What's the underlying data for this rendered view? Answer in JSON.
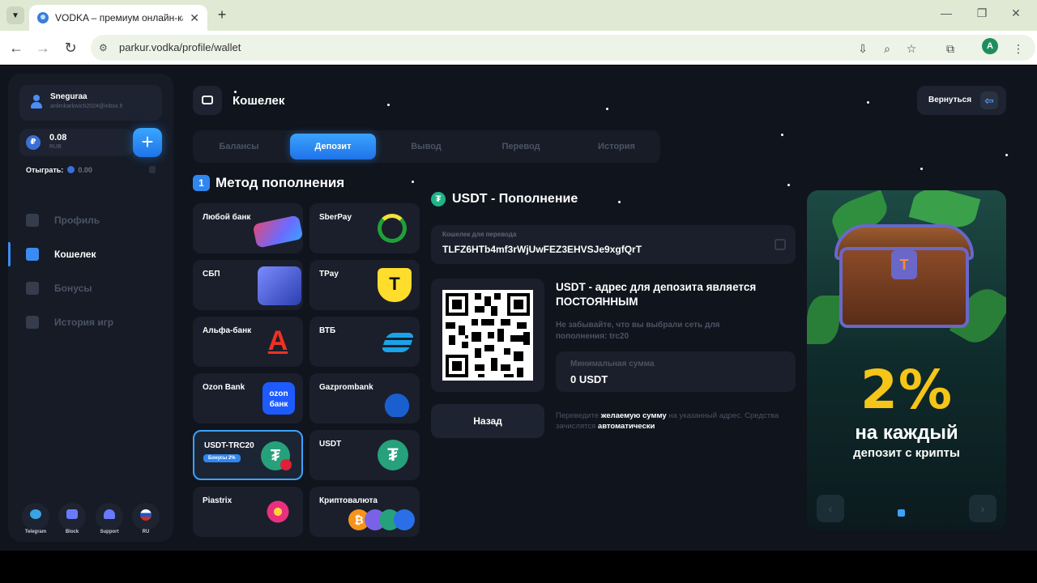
{
  "browser": {
    "tab_title": "VODKA – премиум онлайн-ка",
    "url": "parkur.vodka/profile/wallet",
    "profile_initial": "A"
  },
  "sidebar": {
    "username": "Snegurаа",
    "email": "anlimkаrlovich2024@inbox.lt",
    "balance": "0.08",
    "currency": "RUB",
    "wager_label": "Отыграть:",
    "wager_value": "0.00",
    "menu": [
      {
        "label": "Профиль",
        "icon": "user-icon"
      },
      {
        "label": "Кошелек",
        "icon": "wallet-icon"
      },
      {
        "label": "Бонусы",
        "icon": "gift-icon"
      },
      {
        "label": "История игр",
        "icon": "history-icon"
      }
    ],
    "social": [
      {
        "label": "Telegram",
        "icon": "telegram-icon",
        "color": "#3aa3e3"
      },
      {
        "label": "Block",
        "icon": "lock-icon",
        "color": "#6a7aff"
      },
      {
        "label": "Support",
        "icon": "support-icon",
        "color": "#6a7aff"
      },
      {
        "label": "RU",
        "icon": "russia-flag-icon",
        "color": "#d52b1e"
      }
    ]
  },
  "header": {
    "title": "Кошелек",
    "back_label": "Вернуться"
  },
  "tabs": [
    "Балансы",
    "Депозит",
    "Вывод",
    "Перевод",
    "История"
  ],
  "method": {
    "step": "1",
    "title": "Метод пополнения",
    "cards": [
      {
        "name": "Любой банк"
      },
      {
        "name": "SberPay"
      },
      {
        "name": "СБП"
      },
      {
        "name": "TPay"
      },
      {
        "name": "Альфа-банк"
      },
      {
        "name": "ВТБ"
      },
      {
        "name": "Ozon Bank"
      },
      {
        "name": "Gazprombank"
      },
      {
        "name": "USDT-TRC20",
        "badge": "Бонусы 2%"
      },
      {
        "name": "USDT"
      },
      {
        "name": "Piastrix"
      },
      {
        "name": "Криптовалюта"
      }
    ]
  },
  "deposit": {
    "title": "USDT - Пополнение",
    "wallet_label": "Кошелек для перевода",
    "wallet_address": "TLFZ6HTb4mf3rWjUwFEZ3EHVSJe9xgfQrT",
    "address_heading": "USDT - адрес для депозита является ПОСТОЯННЫМ",
    "network_note": "Не забывайте, что вы выбрали сеть для пополнения: trc20",
    "min_label": "Минимальная сумма",
    "min_value": "0 USDT",
    "back_button": "Назад",
    "note_1": "Переведите",
    "note_bold_1": "желаемую сумму",
    "note_2": "на указанный адрес. Средства зачислятся",
    "note_bold_2": "автоматически"
  },
  "promo": {
    "percent": "2%",
    "line1": "на каждый",
    "line2": "депозит с крипты"
  },
  "colors": {
    "accent": "#2f86f0",
    "page_bg": "#10141d",
    "card_bg": "#1a1f2b",
    "promo_gold": "#f5c518"
  }
}
